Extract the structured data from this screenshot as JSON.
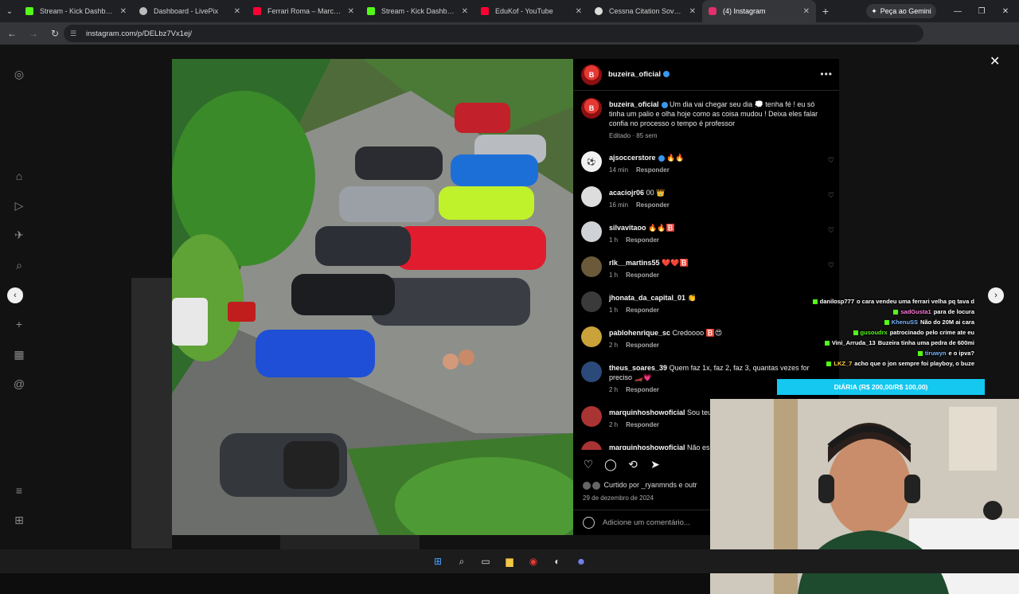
{
  "browser": {
    "tabs": [
      {
        "title": "Stream - Kick Dashboard",
        "color": "#53fc18"
      },
      {
        "title": "Dashboard - LivePix",
        "color": "#bbbbbb"
      },
      {
        "title": "Ferrari Roma – Marcha e Po",
        "color": "#ff0033"
      },
      {
        "title": "Stream - Kick Dashboard",
        "color": "#53fc18"
      },
      {
        "title": "EduKof - YouTube",
        "color": "#ff0033"
      },
      {
        "title": "Cessna Citation Sovereign",
        "color": "#dddddd"
      },
      {
        "title": "(4) Instagram",
        "color": "#e1306c",
        "active": true
      }
    ],
    "gemini_label": "Peça ao Gemini",
    "url": "instagram.com/p/DELbz7Vx1ej/"
  },
  "post": {
    "author": "buzeira_oficial",
    "caption": "Um dia vai chegar seu dia 💭 tenha fé ! eu só tinha um palio e olha hoje como as coisa mudou ! Deixa eles falar confia no processo o tempo é professor",
    "caption_meta": "Editado · 85 sem",
    "liked_by": "Curtido por _ryanmnds e outr",
    "date": "29 de dezembro de 2024",
    "add_comment_placeholder": "Adicione um comentário...",
    "reply_label": "Responder"
  },
  "comments": [
    {
      "user": "ajsoccerstore",
      "text": "🔥🔥",
      "time": "14 min",
      "verified": true
    },
    {
      "user": "acaciojr06",
      "text": "00 👑",
      "time": "16 min"
    },
    {
      "user": "silvavitaoo",
      "text": "🔥🔥🅱️",
      "time": "1 h"
    },
    {
      "user": "rlk__martins55",
      "text": "❤️❤️🅱️",
      "time": "1 h"
    },
    {
      "user": "jhonata_da_capital_01",
      "text": "👏",
      "time": "1 h"
    },
    {
      "user": "pablohenrique_sc",
      "text": "Credoooo 🅱️😍",
      "time": "2 h"
    },
    {
      "user": "theus_soares_39",
      "text": "Quem faz 1x, faz 2, faz 3, quantas vezes for preciso 🏎️💗",
      "time": "2 h"
    },
    {
      "user": "marquinhoshowoficial",
      "text": "Sou teu",
      "time": "2 h"
    },
    {
      "user": "marquinhoshowoficial",
      "text": "Não es",
      "time": ""
    }
  ],
  "stream_chat": [
    {
      "user": "danilosp777",
      "text": "o cara vendeu uma ferrari velha pq tava d"
    },
    {
      "user": "sadGusta1",
      "text": "para de locura"
    },
    {
      "user": "KhenuSS",
      "text": "Não do 20M ai cara"
    },
    {
      "user": "gusoudrx",
      "text": "patrocinado pelo crime ate eu"
    },
    {
      "user": "Vini_Arruda_13",
      "text": "Buzeira tinha uma pedra de 600mi"
    },
    {
      "user": "tiruwyn",
      "text": "e o ipva?"
    },
    {
      "user": "LKZ_7",
      "text": "acho que o jon sempre foi playboy, o buze"
    }
  ],
  "stream_banner": "DIÁRIA (R$ 200,00/R$ 100,00)",
  "colors": {
    "accent": "#3897f0",
    "kick": "#53fc18",
    "banner": "#14c8f0"
  }
}
